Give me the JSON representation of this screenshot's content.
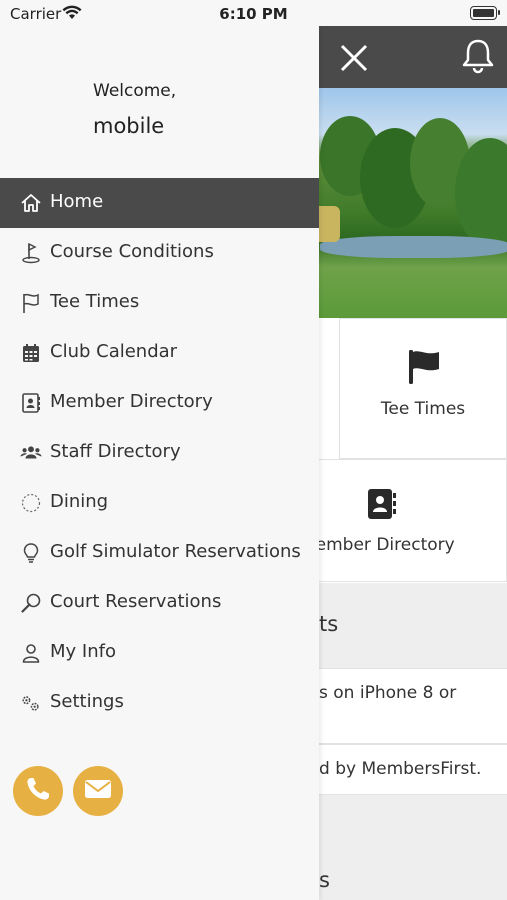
{
  "status_bar": {
    "carrier": "Carrier",
    "time": "6:10 PM"
  },
  "drawer": {
    "welcome": "Welcome,",
    "username": "mobile",
    "menu": [
      {
        "label": "Home",
        "icon": "home-icon",
        "active": true
      },
      {
        "label": "Course Conditions",
        "icon": "golf-flag-icon"
      },
      {
        "label": "Tee Times",
        "icon": "flag-icon"
      },
      {
        "label": "Club Calendar",
        "icon": "calendar-icon"
      },
      {
        "label": "Member Directory",
        "icon": "address-book-icon"
      },
      {
        "label": "Staff Directory",
        "icon": "users-icon"
      },
      {
        "label": "Dining",
        "icon": "plate-icon"
      },
      {
        "label": "Golf Simulator Reservations",
        "icon": "lightbulb-icon"
      },
      {
        "label": "Court Reservations",
        "icon": "racket-icon"
      },
      {
        "label": "My Info",
        "icon": "user-icon"
      },
      {
        "label": "Settings",
        "icon": "gears-icon"
      }
    ],
    "actions": [
      {
        "name": "phone-button",
        "icon": "phone-icon"
      },
      {
        "name": "email-button",
        "icon": "envelope-icon"
      }
    ]
  },
  "background": {
    "tiles": [
      {
        "label": "Tee Times",
        "icon": "flag-icon"
      },
      {
        "label": "Member Directory",
        "icon": "address-book-icon"
      }
    ],
    "section_title_1": "ts",
    "list_items": [
      "s on iPhone 8 or",
      "d by MembersFirst."
    ],
    "section_title_2": "s"
  },
  "colors": {
    "header_bg": "#4a4a4a",
    "drawer_bg": "#f7f7f7",
    "active_item_bg": "#4a4a4a",
    "accent": "#e7b042"
  }
}
